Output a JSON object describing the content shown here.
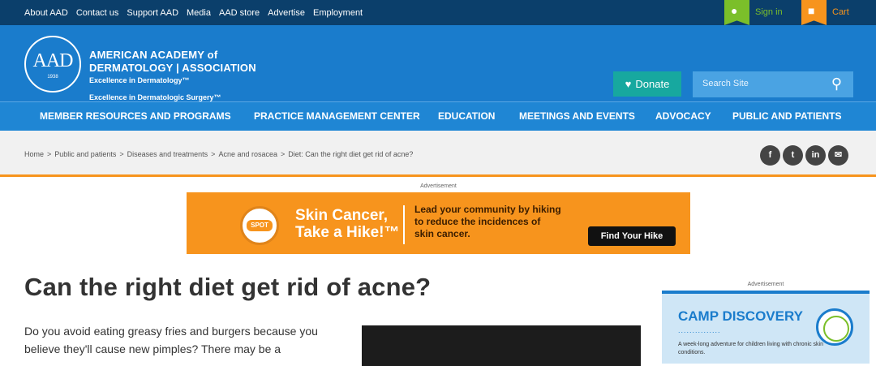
{
  "topbar": {
    "links": [
      "About AAD",
      "Contact us",
      "Support AAD",
      "Media",
      "AAD store",
      "Advertise",
      "Employment"
    ],
    "signin": "Sign in",
    "cart": "Cart"
  },
  "header": {
    "org_line1": "AMERICAN ACADEMY of",
    "org_line2": "DERMATOLOGY | ASSOCIATION",
    "tagline1": "Excellence in Dermatology™",
    "tagline2": "Excellence in Dermatologic Surgery™",
    "logo_letters": "AAD",
    "logo_year": "1938",
    "donate": "Donate",
    "search_placeholder": "Search Site"
  },
  "nav": [
    "MEMBER RESOURCES AND PROGRAMS",
    "PRACTICE MANAGEMENT CENTER",
    "EDUCATION",
    "MEETINGS AND EVENTS",
    "ADVOCACY",
    "PUBLIC AND PATIENTS"
  ],
  "breadcrumb": [
    "Home",
    "Public and patients",
    "Diseases and treatments",
    "Acne and rosacea",
    "Diet: Can the right diet get rid of acne?"
  ],
  "social": [
    "f",
    "t",
    "in",
    "✉"
  ],
  "ad": {
    "label": "Advertisement",
    "spot": "SPOT",
    "headline1": "Skin Cancer,",
    "headline2": "Take a Hike!™",
    "lead1": "Lead your community by hiking",
    "lead2": "to reduce the incidences of",
    "lead3": "skin cancer.",
    "cta": "Find Your Hike"
  },
  "article": {
    "title": "Can the right diet get rid of acne?",
    "intro_line1": "Do you avoid eating greasy fries and burgers because you",
    "intro_line2": "believe they'll cause new pimples? There may be a"
  },
  "sidebar_ad": {
    "label": "Advertisement",
    "title": "CAMP DISCOVERY",
    "dots": "...............",
    "desc": "A week-long adventure for children living with chronic skin conditions."
  }
}
